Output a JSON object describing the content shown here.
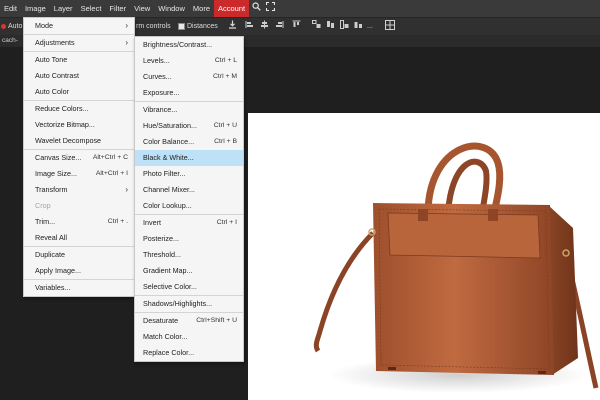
{
  "menubar": {
    "items": [
      "Edit",
      "Image",
      "Layer",
      "Select",
      "Filter",
      "View",
      "Window",
      "More",
      "Account"
    ],
    "active": "Account",
    "search_icon": "search-icon",
    "fullscreen_icon": "fullscreen-icon"
  },
  "toolbar": {
    "auto_label": "Auto",
    "transform_label": "rm controls",
    "distances_label": "Distances",
    "dots": "..."
  },
  "tab": {
    "label": "cach-"
  },
  "image_menu": {
    "items": [
      {
        "label": "Mode",
        "arrow": "›"
      },
      {
        "sep": true
      },
      {
        "label": "Adjustments",
        "arrow": "›"
      },
      {
        "sep": true
      },
      {
        "label": "Auto Tone"
      },
      {
        "label": "Auto Contrast"
      },
      {
        "label": "Auto Color"
      },
      {
        "sep": true
      },
      {
        "label": "Reduce Colors..."
      },
      {
        "label": "Vectorize Bitmap..."
      },
      {
        "label": "Wavelet Decompose"
      },
      {
        "sep": true
      },
      {
        "label": "Canvas Size...",
        "shortcut": "Alt+Ctrl + C"
      },
      {
        "label": "Image Size...",
        "shortcut": "Alt+Ctrl + I"
      },
      {
        "label": "Transform",
        "arrow": "›"
      },
      {
        "label": "Crop",
        "disabled": true
      },
      {
        "label": "Trim...",
        "shortcut": "Ctrl + ."
      },
      {
        "label": "Reveal All"
      },
      {
        "sep": true
      },
      {
        "label": "Duplicate"
      },
      {
        "label": "Apply Image..."
      },
      {
        "sep": true
      },
      {
        "label": "Variables..."
      }
    ]
  },
  "adjustments_menu": {
    "items": [
      {
        "label": "Brightness/Contrast..."
      },
      {
        "label": "Levels...",
        "shortcut": "Ctrl + L"
      },
      {
        "label": "Curves...",
        "shortcut": "Ctrl + M"
      },
      {
        "label": "Exposure..."
      },
      {
        "sep": true
      },
      {
        "label": "Vibrance..."
      },
      {
        "label": "Hue/Saturation...",
        "shortcut": "Ctrl + U"
      },
      {
        "label": "Color Balance...",
        "shortcut": "Ctrl + B"
      },
      {
        "label": "Black & White...",
        "highlighted": true
      },
      {
        "label": "Photo Filter..."
      },
      {
        "label": "Channel Mixer..."
      },
      {
        "label": "Color Lookup..."
      },
      {
        "sep": true
      },
      {
        "label": "Invert",
        "shortcut": "Ctrl + I"
      },
      {
        "label": "Posterize..."
      },
      {
        "label": "Threshold..."
      },
      {
        "label": "Gradient Map..."
      },
      {
        "label": "Selective Color..."
      },
      {
        "sep": true
      },
      {
        "label": "Shadows/Highlights..."
      },
      {
        "sep": true
      },
      {
        "label": "Desaturate",
        "shortcut": "Ctrl+Shift + U"
      },
      {
        "label": "Match Color..."
      },
      {
        "label": "Replace Color..."
      }
    ]
  },
  "colors": {
    "accent": "#cc2a2a",
    "highlight": "#bde1f6",
    "bag": "#b5623a"
  }
}
